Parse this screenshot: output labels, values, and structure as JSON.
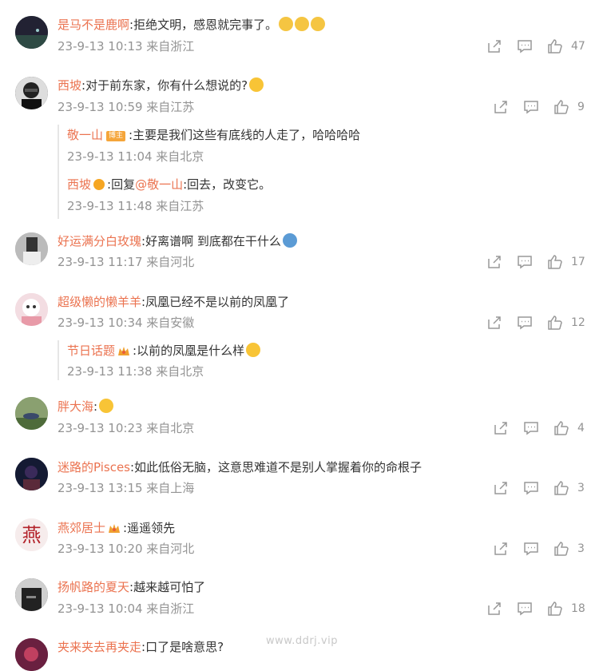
{
  "comments": [
    {
      "username": "是马不是鹿啊",
      "text": ":拒绝文明，感恩就完事了。",
      "emojis": [
        "scream-emoji",
        "scream-emoji",
        "scream-emoji"
      ],
      "meta": "23-9-13 10:13 来自浙江",
      "likes": "47",
      "avatar_color": "#1f3a3a"
    },
    {
      "username": "西坡",
      "text": ":对于前东家，你有什么想说的?",
      "emojis": [
        "grin-emoji"
      ],
      "meta": "23-9-13 10:59 来自江苏",
      "likes": "9",
      "avatar_color": "#2a2a2a",
      "replies": [
        {
          "username": "敬一山",
          "badge": "博主",
          "text": ":主要是我们这些有底线的人走了，哈哈哈哈",
          "meta": "23-9-13 11:04 来自北京"
        },
        {
          "username": "西坡",
          "reply_prefix": ":回复",
          "at": "@敬一山",
          "text": ":回去，改变它。",
          "meta": "23-9-13 11:48 来自江苏"
        }
      ]
    },
    {
      "username": "好运满分白玫瑰",
      "text": ":好离谱啊 到底都在干什么",
      "emojis": [
        "doge-emoji"
      ],
      "meta": "23-9-13 11:17 来自河北",
      "likes": "17",
      "avatar_color": "#888"
    },
    {
      "username": "超级懒的懒羊羊",
      "text": ":凤凰已经不是以前的凤凰了",
      "emojis": [],
      "meta": "23-9-13 10:34 来自安徽",
      "likes": "12",
      "avatar_color": "#e9b7c0",
      "replies": [
        {
          "username": "节日话题",
          "text": ":以前的凤凰是什么样",
          "meta": "23-9-13 11:38 来自北京"
        }
      ]
    },
    {
      "username": "胖大海",
      "text": ":",
      "emojis": [
        "cry-emoji"
      ],
      "meta": "23-9-13 10:23 来自北京",
      "likes": "4",
      "avatar_color": "#6d8c5a"
    },
    {
      "username": "迷路的Pisces",
      "text": ":如此低俗无脑，这意思难道不是别人掌握着你的命根子",
      "emojis": [],
      "meta": "23-9-13 13:15 来自上海",
      "likes": "3",
      "avatar_color": "#1b2340"
    },
    {
      "username": "燕郊居士",
      "text": ":遥遥领先",
      "emojis": [],
      "meta": "23-9-13 10:20 来自河北",
      "likes": "3",
      "avatar_color": "#f4e6e6",
      "avatar_glyph": "燕"
    },
    {
      "username": "扬帆路的夏天",
      "text": ":越来越可怕了",
      "emojis": [],
      "meta": "23-9-13 10:04 来自浙江",
      "likes": "18",
      "avatar_color": "#3a3a3a"
    },
    {
      "username": "夹来夹去再夹走",
      "text": ":口了是啥意思?",
      "emojis": [],
      "avatar_color": "#5a1f3a"
    }
  ],
  "watermark": "www.ddrj.vip",
  "colors": {
    "username": "#eb7350",
    "meta": "#939393",
    "accent_badge": "#f6a623"
  }
}
